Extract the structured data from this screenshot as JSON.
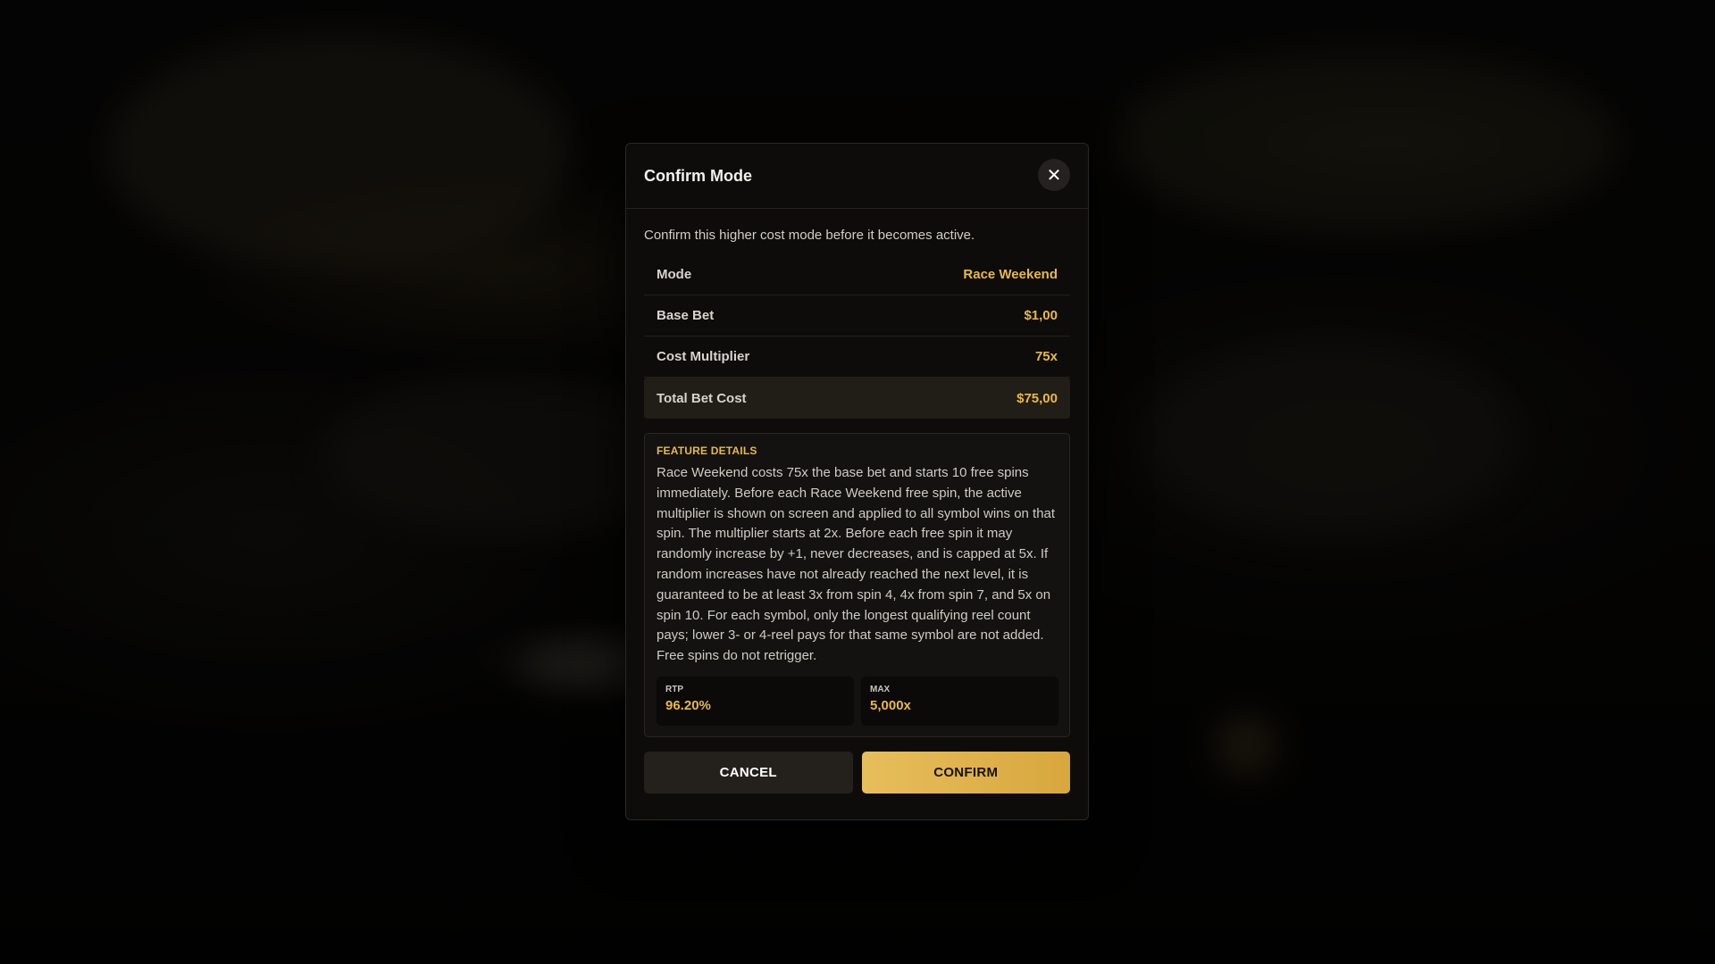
{
  "modal": {
    "title": "Confirm Mode",
    "close_icon": "close-icon",
    "close_glyph": "✕",
    "intro": "Confirm this higher cost mode before it becomes active."
  },
  "summary": {
    "rows": [
      {
        "label": "Mode",
        "value": "Race Weekend"
      },
      {
        "label": "Base Bet",
        "value": "$1,00"
      },
      {
        "label": "Cost Multiplier",
        "value": "75x"
      },
      {
        "label": "Total Bet Cost",
        "value": "$75,00"
      }
    ]
  },
  "features": {
    "heading": "FEATURE DETAILS",
    "text": "Race Weekend costs 75x the base bet and starts 10 free spins immediately. Before each Race Weekend free spin, the active multiplier is shown on screen and applied to all symbol wins on that spin. The multiplier starts at 2x. Before each free spin it may randomly increase by +1, never decreases, and is capped at 5x. If random increases have not already reached the next level, it is guaranteed to be at least 3x from spin 4, 4x from spin 7, and 5x on spin 10. For each symbol, only the longest qualifying reel count pays; lower 3- or 4-reel pays for that same symbol are not added. Free spins do not retrigger.",
    "stats": [
      {
        "label": "RTP",
        "value": "96.20%"
      },
      {
        "label": "MAX",
        "value": "5,000x"
      }
    ]
  },
  "actions": {
    "cancel_label": "CANCEL",
    "confirm_label": "CONFIRM"
  },
  "colors": {
    "accent": "#e8b84b",
    "modal_bg": "#0d0c0b",
    "confirm_gradient_start": "#e7be5c",
    "confirm_gradient_end": "#d8a73e"
  }
}
